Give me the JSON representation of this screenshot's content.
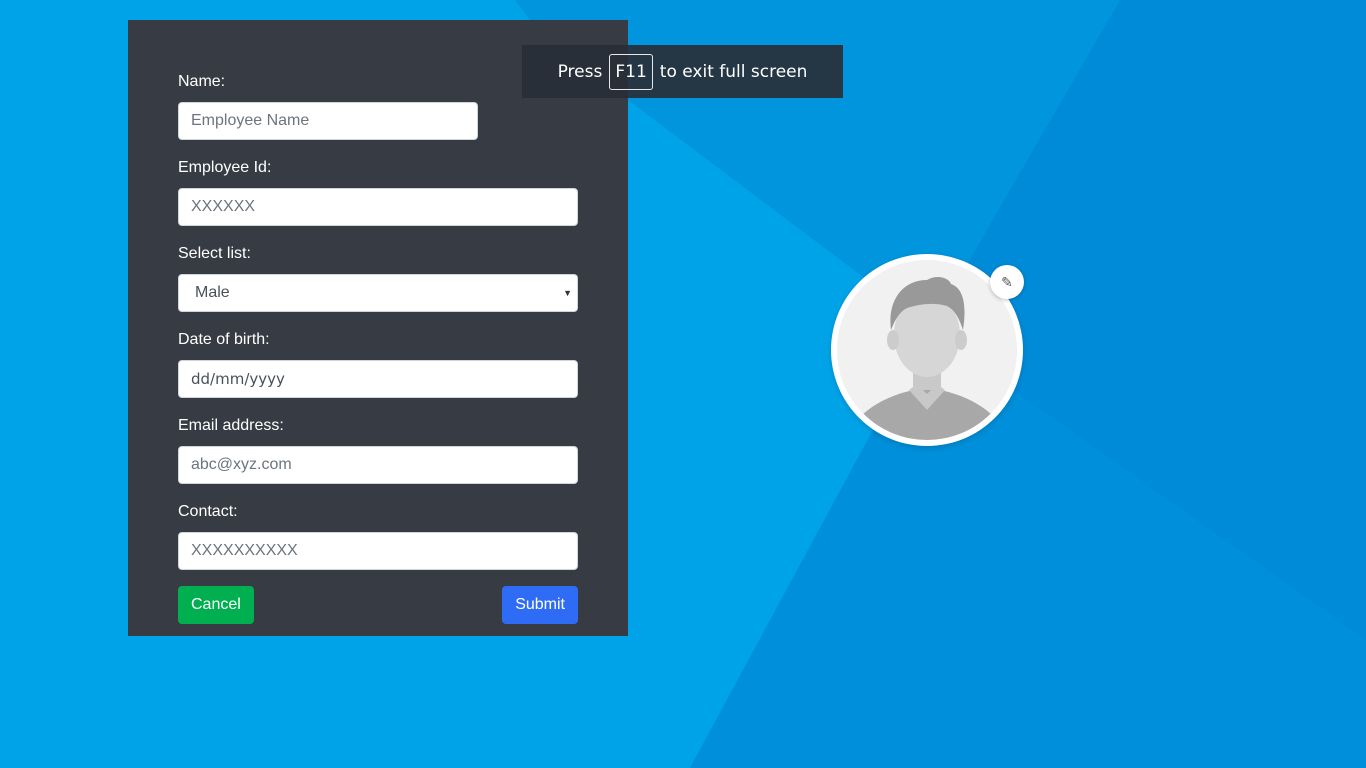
{
  "form": {
    "name": {
      "label": "Name:",
      "placeholder": "Employee Name"
    },
    "employee_id": {
      "label": "Employee Id:",
      "placeholder": "XXXXXX"
    },
    "select_list": {
      "label": "Select list:",
      "selected": "Male"
    },
    "dob": {
      "label": "Date of birth:",
      "value": "dd/mm/yyyy"
    },
    "email": {
      "label": "Email address:",
      "placeholder": "abc@xyz.com"
    },
    "contact": {
      "label": "Contact:",
      "placeholder": "XXXXXXXXXX"
    },
    "cancel_label": "Cancel",
    "submit_label": "Submit"
  },
  "fullscreen_notice": {
    "prefix": "Press",
    "key": "F11",
    "suffix": "to exit full screen"
  },
  "avatar": {
    "icon": "user-avatar-placeholder",
    "edit_icon": "pencil-icon"
  },
  "colors": {
    "background": "#00a3e8",
    "panel": "#373b43",
    "cancel": "#00b050",
    "submit": "#2f6cf6"
  }
}
